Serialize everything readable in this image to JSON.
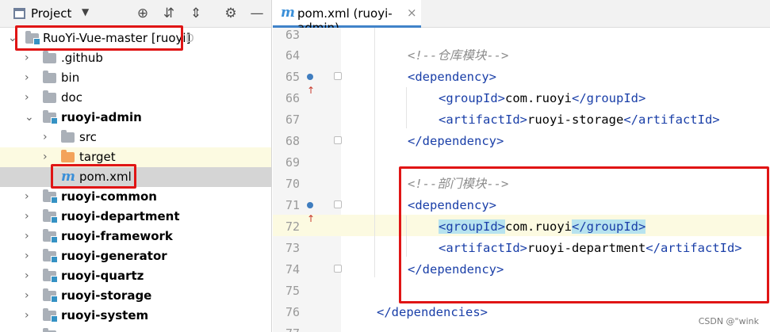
{
  "project_panel": {
    "title": "Project",
    "tree": [
      {
        "label": "RuoYi-Vue-master [ruoyi]",
        "suffix": "D"
      },
      {
        "label": ".github"
      },
      {
        "label": "bin"
      },
      {
        "label": "doc"
      },
      {
        "label": "ruoyi-admin"
      },
      {
        "label": "src"
      },
      {
        "label": "target"
      },
      {
        "label": "pom.xml"
      },
      {
        "label": "ruoyi-common"
      },
      {
        "label": "ruoyi-department"
      },
      {
        "label": "ruoyi-framework"
      },
      {
        "label": "ruoyi-generator"
      },
      {
        "label": "ruoyi-quartz"
      },
      {
        "label": "ruoyi-storage"
      },
      {
        "label": "ruoyi-system"
      }
    ]
  },
  "editor": {
    "tab_label": "pom.xml (ruoyi-admin)",
    "file_icon": "m",
    "lines": [
      {
        "num": "63"
      },
      {
        "num": "64",
        "parts": [
          {
            "cls": "cmt",
            "t": "<!--仓库模块-->"
          }
        ]
      },
      {
        "num": "65",
        "parts": [
          {
            "cls": "tag",
            "t": "<dependency>"
          }
        ]
      },
      {
        "num": "66",
        "parts": [
          {
            "cls": "tag",
            "t": "<groupId>"
          },
          {
            "cls": "txt",
            "t": "com.ruoyi"
          },
          {
            "cls": "tag",
            "t": "</groupId>"
          }
        ]
      },
      {
        "num": "67",
        "parts": [
          {
            "cls": "tag",
            "t": "<artifactId>"
          },
          {
            "cls": "txt",
            "t": "ruoyi-storage"
          },
          {
            "cls": "tag",
            "t": "</artifactId>"
          }
        ]
      },
      {
        "num": "68",
        "parts": [
          {
            "cls": "tag",
            "t": "</dependency>"
          }
        ]
      },
      {
        "num": "69"
      },
      {
        "num": "70",
        "parts": [
          {
            "cls": "cmt",
            "t": "<!--部门模块-->"
          }
        ]
      },
      {
        "num": "71",
        "parts": [
          {
            "cls": "tag",
            "t": "<dependency>"
          }
        ]
      },
      {
        "num": "72",
        "parts": [
          {
            "cls": "tag hl",
            "t": "<groupId>"
          },
          {
            "cls": "txt",
            "t": "com.ruoyi"
          },
          {
            "cls": "tag hl",
            "t": "</groupId>"
          }
        ]
      },
      {
        "num": "73",
        "parts": [
          {
            "cls": "tag",
            "t": "<artifactId>"
          },
          {
            "cls": "txt",
            "t": "ruoyi-department"
          },
          {
            "cls": "tag",
            "t": "</artifactId>"
          }
        ]
      },
      {
        "num": "74",
        "parts": [
          {
            "cls": "tag",
            "t": "</dependency>"
          }
        ]
      },
      {
        "num": "75"
      },
      {
        "num": "76",
        "parts": [
          {
            "cls": "tag",
            "t": "</dependencies>"
          }
        ]
      },
      {
        "num": "77"
      }
    ]
  },
  "watermark": "CSDN @\"wink",
  "colors": {
    "highlight_box": "#e01515",
    "tag": "#1a3fa8",
    "comment": "#8c8c8c",
    "tab_underline": "#4083c9"
  }
}
